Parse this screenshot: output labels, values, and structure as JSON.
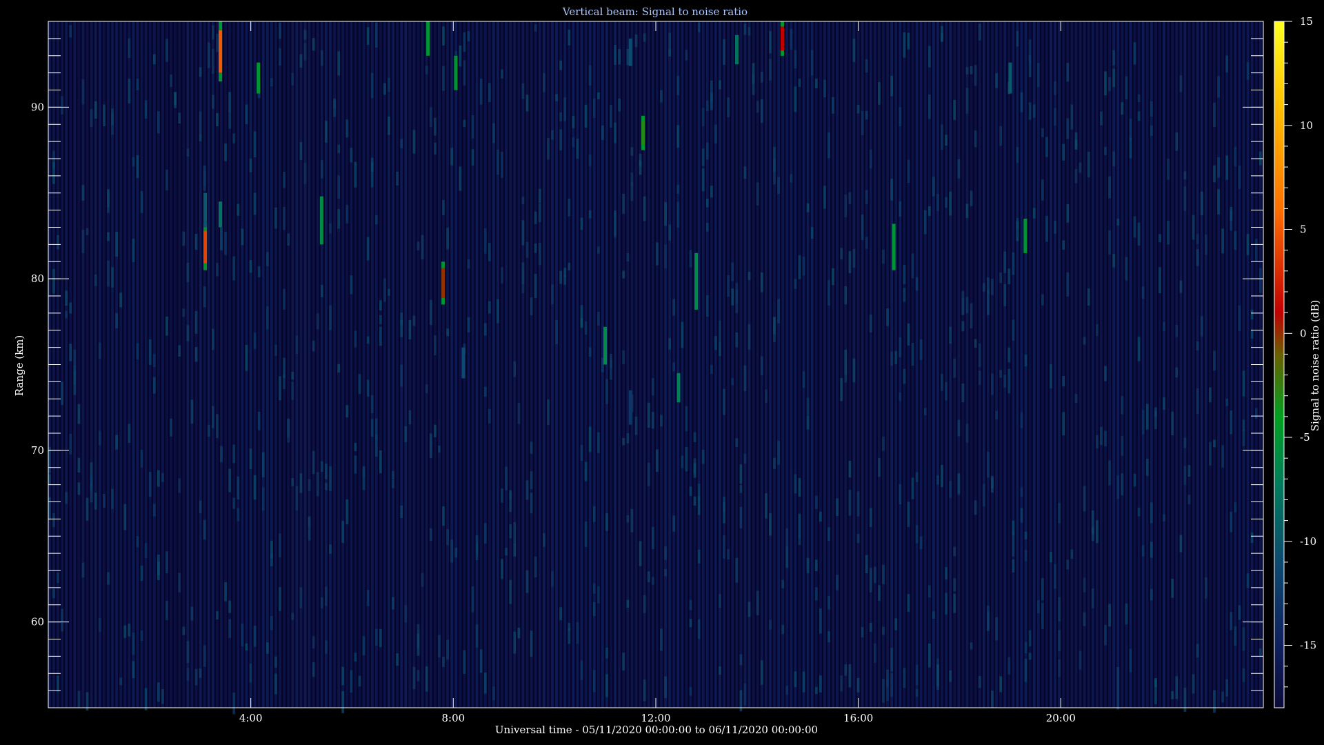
{
  "chart_data": {
    "type": "heatmap",
    "title": "Vertical beam: Signal to noise ratio",
    "xlabel": "Universal time - 05/11/2020 00:00:00 to 06/11/2020 00:00:00",
    "ylabel": "Range (km)",
    "colorbar_label": "Signal to noise ratio (dB)",
    "x_range_hours": [
      0,
      24
    ],
    "y_range_km": [
      55,
      95
    ],
    "color_range_db": [
      -18,
      15
    ],
    "x_ticks": [
      {
        "hour": 4,
        "label": "4:00"
      },
      {
        "hour": 8,
        "label": "8:00"
      },
      {
        "hour": 12,
        "label": "12:00"
      },
      {
        "hour": 16,
        "label": "16:00"
      },
      {
        "hour": 20,
        "label": "20:00"
      }
    ],
    "y_ticks": [
      {
        "km": 60,
        "label": "60"
      },
      {
        "km": 70,
        "label": "70"
      },
      {
        "km": 80,
        "label": "80"
      },
      {
        "km": 90,
        "label": "90"
      }
    ],
    "colorbar_ticks": [
      {
        "db": 15,
        "label": "15"
      },
      {
        "db": 10,
        "label": "10"
      },
      {
        "db": 5,
        "label": "5"
      },
      {
        "db": 0,
        "label": "0"
      },
      {
        "db": -5,
        "label": "-5"
      },
      {
        "db": -10,
        "label": "-10"
      },
      {
        "db": -15,
        "label": "-15"
      }
    ],
    "background_level_db": -16,
    "colormap": [
      {
        "db": -18,
        "color": "#0b0b3a"
      },
      {
        "db": -15,
        "color": "#10205e"
      },
      {
        "db": -11,
        "color": "#0d4a70"
      },
      {
        "db": -7,
        "color": "#00805a"
      },
      {
        "db": -4,
        "color": "#00a020"
      },
      {
        "db": -1,
        "color": "#6a6000"
      },
      {
        "db": 1,
        "color": "#c00000"
      },
      {
        "db": 6,
        "color": "#ff7000"
      },
      {
        "db": 11,
        "color": "#ffc000"
      },
      {
        "db": 15,
        "color": "#ffff20"
      }
    ],
    "echoes": [
      {
        "hour": 3.1,
        "km_from": 80.5,
        "km_to": 83.2,
        "peak_db": 4
      },
      {
        "hour": 3.1,
        "km_from": 83.0,
        "km_to": 85.0,
        "peak_db": -10
      },
      {
        "hour": 3.4,
        "km_from": 91.5,
        "km_to": 95.0,
        "peak_db": 5
      },
      {
        "hour": 3.4,
        "km_from": 83.0,
        "km_to": 84.5,
        "peak_db": -8
      },
      {
        "hour": 4.15,
        "km_from": 90.8,
        "km_to": 92.6,
        "peak_db": -5
      },
      {
        "hour": 5.4,
        "km_from": 82.0,
        "km_to": 84.8,
        "peak_db": -6
      },
      {
        "hour": 7.5,
        "km_from": 93.0,
        "km_to": 95.0,
        "peak_db": -5
      },
      {
        "hour": 7.8,
        "km_from": 78.5,
        "km_to": 81.0,
        "peak_db": 0
      },
      {
        "hour": 8.05,
        "km_from": 91.0,
        "km_to": 93.0,
        "peak_db": -5
      },
      {
        "hour": 8.2,
        "km_from": 74.2,
        "km_to": 76.0,
        "peak_db": -11
      },
      {
        "hour": 11.0,
        "km_from": 75.0,
        "km_to": 77.2,
        "peak_db": -6
      },
      {
        "hour": 11.5,
        "km_from": 71.5,
        "km_to": 73.5,
        "peak_db": -13
      },
      {
        "hour": 11.75,
        "km_from": 87.5,
        "km_to": 89.5,
        "peak_db": -3
      },
      {
        "hour": 11.5,
        "km_from": 92.4,
        "km_to": 94.0,
        "peak_db": -11
      },
      {
        "hour": 12.45,
        "km_from": 72.8,
        "km_to": 74.5,
        "peak_db": -7
      },
      {
        "hour": 12.8,
        "km_from": 78.2,
        "km_to": 81.5,
        "peak_db": -6
      },
      {
        "hour": 13.6,
        "km_from": 92.5,
        "km_to": 94.2,
        "peak_db": -8
      },
      {
        "hour": 14.5,
        "km_from": 93.0,
        "km_to": 95.0,
        "peak_db": 1
      },
      {
        "hour": 16.7,
        "km_from": 80.5,
        "km_to": 83.2,
        "peak_db": -5
      },
      {
        "hour": 19.0,
        "km_from": 90.8,
        "km_to": 92.6,
        "peak_db": -10
      },
      {
        "hour": 19.3,
        "km_from": 81.5,
        "km_to": 83.5,
        "peak_db": -5
      }
    ]
  }
}
